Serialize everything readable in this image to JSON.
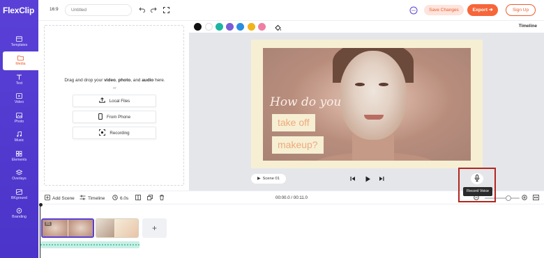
{
  "app": {
    "name": "FlexClip"
  },
  "sidebar": {
    "items": [
      {
        "label": "Templates",
        "icon": "templates-icon"
      },
      {
        "label": "Media",
        "icon": "media-folder-icon",
        "active": true
      },
      {
        "label": "Text",
        "icon": "text-icon"
      },
      {
        "label": "Video",
        "icon": "video-icon"
      },
      {
        "label": "Photo",
        "icon": "photo-icon"
      },
      {
        "label": "Music",
        "icon": "music-icon"
      },
      {
        "label": "Elements",
        "icon": "elements-icon"
      },
      {
        "label": "Overlays",
        "icon": "overlays-icon"
      },
      {
        "label": "BKground",
        "icon": "background-icon"
      },
      {
        "label": "Branding",
        "icon": "branding-icon"
      }
    ]
  },
  "topbar": {
    "ratio": "16:9",
    "title_placeholder": "Untitled",
    "save_label": "Save Changes",
    "export_label": "Export",
    "signup_label": "Sign Up"
  },
  "media_panel": {
    "drop_text_prefix": "Drag and drop your",
    "drop_video": "video",
    "drop_photo": "photo",
    "drop_and": ", and",
    "drop_audio": "audio",
    "drop_suffix": "here.",
    "or": "or",
    "local_files": "Local Files",
    "from_phone": "From Phone",
    "recording": "Recording"
  },
  "preview": {
    "timeline_label": "Timeline",
    "palette": [
      "#111111",
      "#ffffff",
      "#1bb5a3",
      "#7a5cd6",
      "#2a8de0",
      "#f2b31a",
      "#ee7fa3"
    ],
    "script_text": "How do you",
    "line1": "take off",
    "line2": "makeup?",
    "scene_label": "Scene 01"
  },
  "tooltip": {
    "text": "Record Voice"
  },
  "bottom_bar": {
    "add_scene": "Add Scene",
    "timeline": "Timeline",
    "duration": "6.0s",
    "time": "00:00.0 / 00:11.0"
  },
  "timeline": {
    "clip1_num": "01"
  }
}
